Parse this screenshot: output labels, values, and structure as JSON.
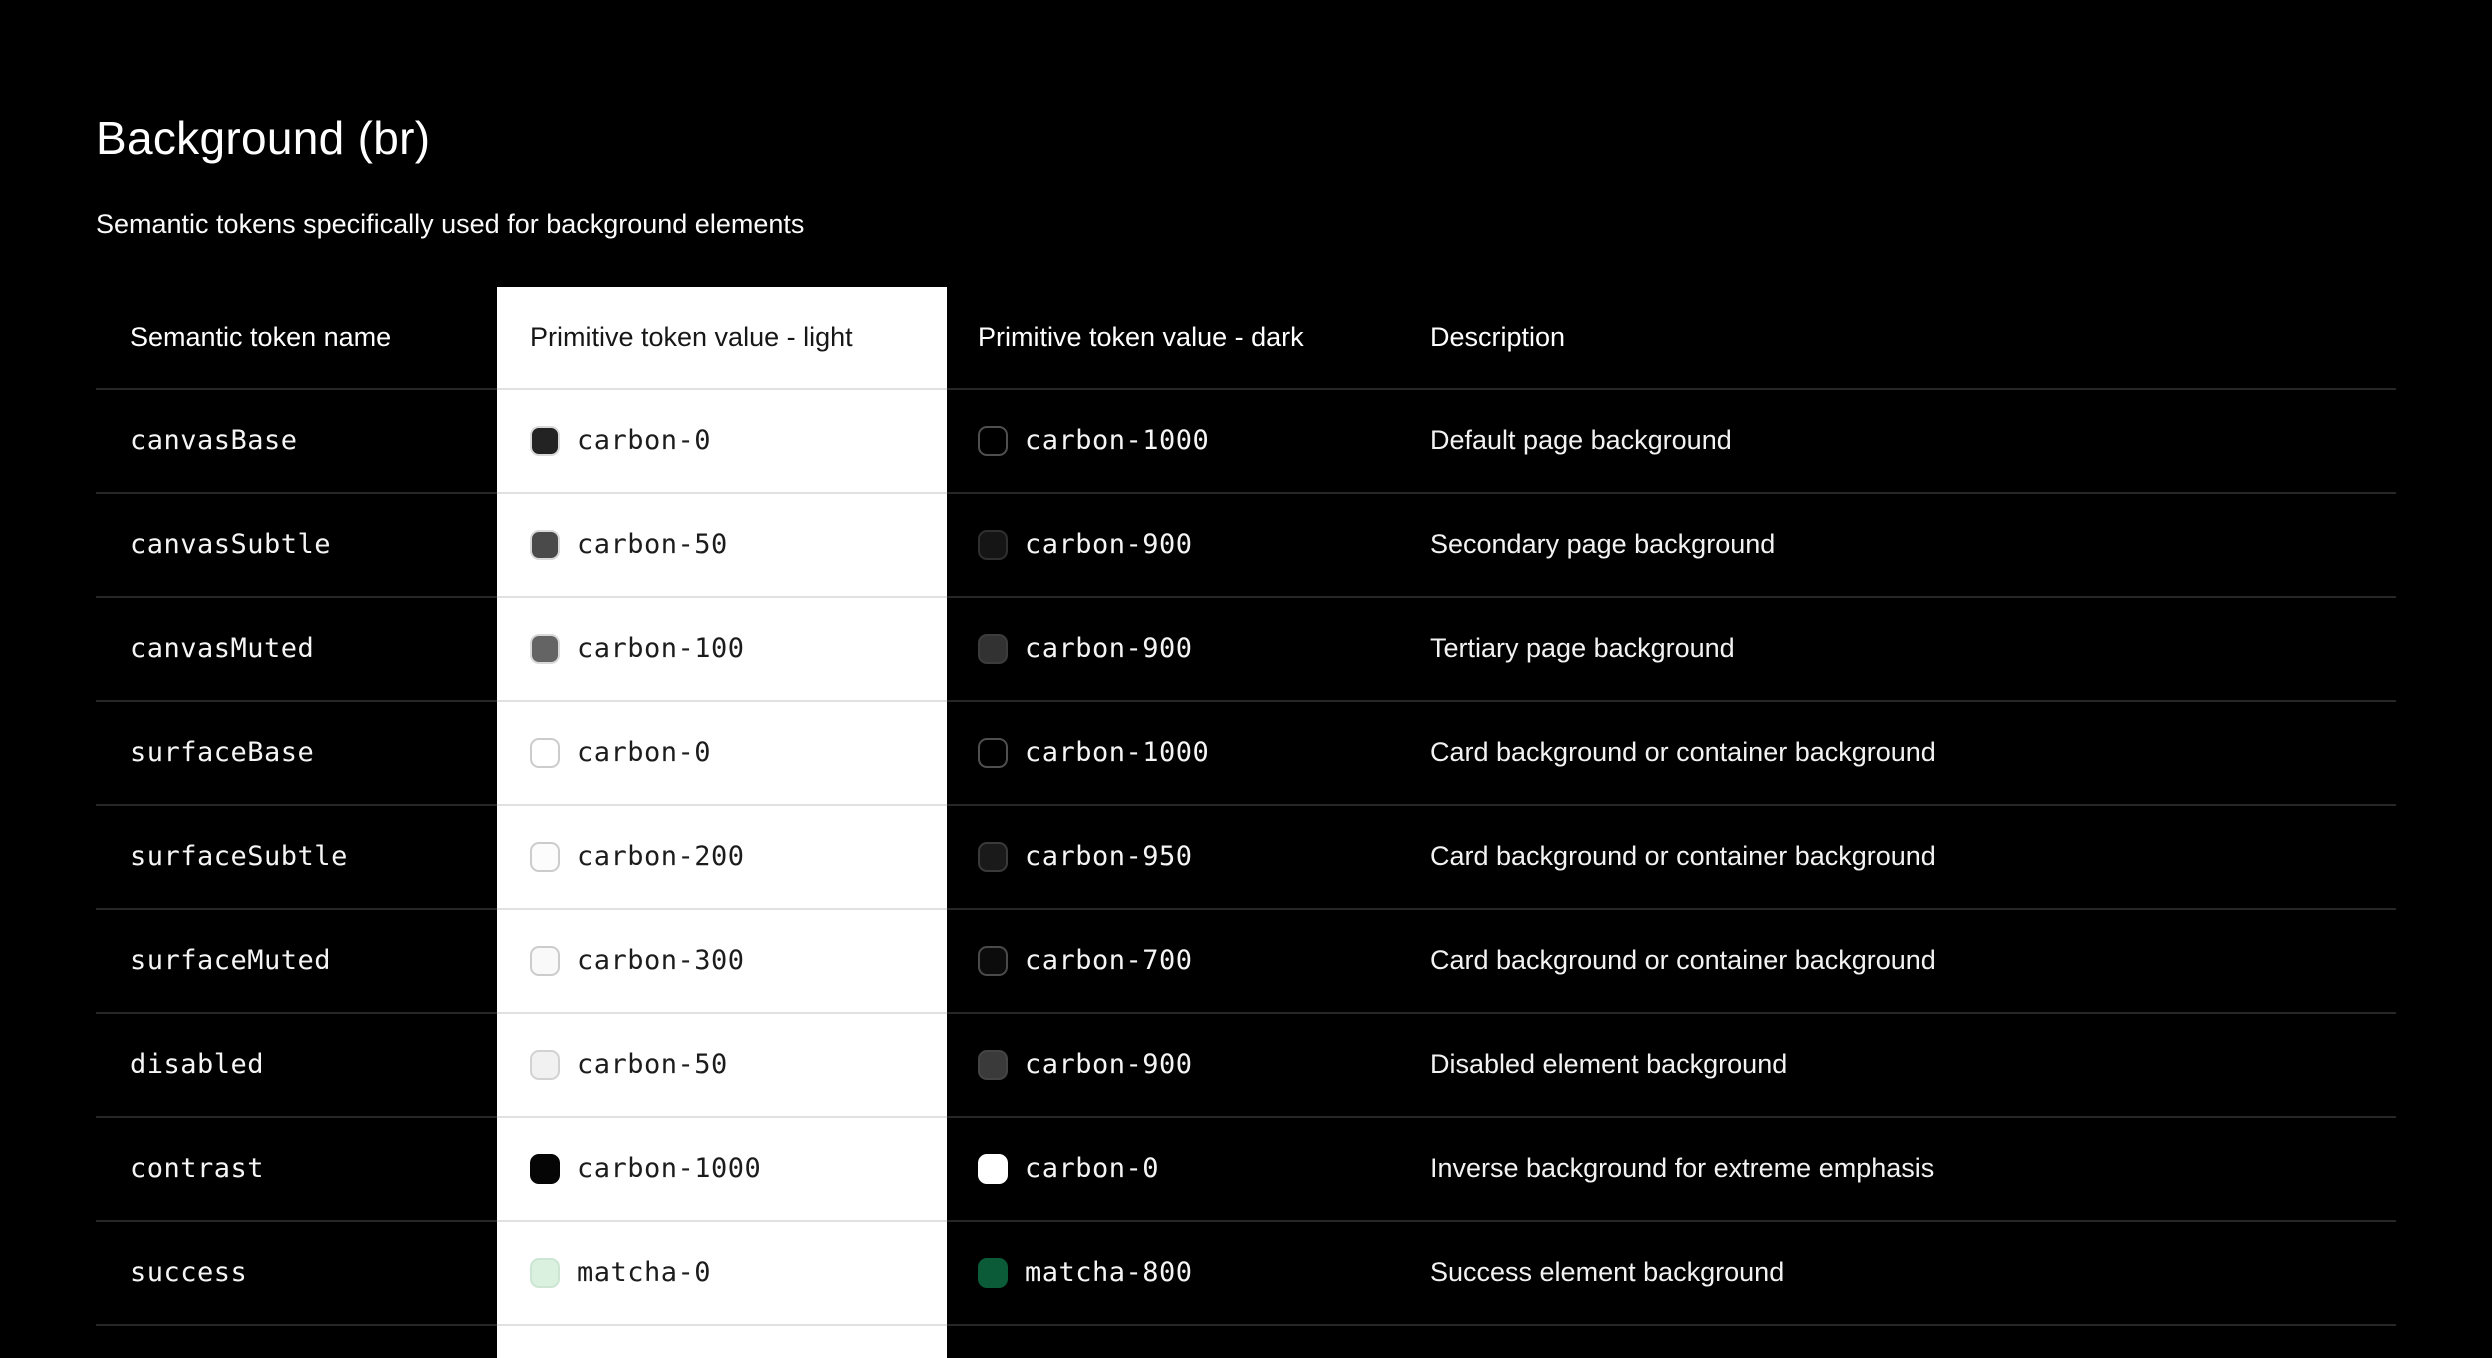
{
  "page": {
    "title": "Background (br)",
    "subtitle": "Semantic tokens specifically used for background elements"
  },
  "table": {
    "columns": [
      "Semantic token name",
      "Primitive token value - light",
      "Primitive token value - dark",
      "Description"
    ],
    "rows": [
      {
        "token": "canvasBase",
        "light": {
          "value": "carbon-0",
          "fill": "#232323",
          "border": "#d9d9d9"
        },
        "dark": {
          "value": "carbon-1000",
          "fill": "#000000",
          "border": "#4f4f4f"
        },
        "description": "Default page background"
      },
      {
        "token": "canvasSubtle",
        "light": {
          "value": "carbon-50",
          "fill": "#4a4a4a",
          "border": "#d9d9d9"
        },
        "dark": {
          "value": "carbon-900",
          "fill": "#151515",
          "border": "#2f2f2f"
        },
        "description": "Secondary page background"
      },
      {
        "token": "canvasMuted",
        "light": {
          "value": "carbon-100",
          "fill": "#646464",
          "border": "#d9d9d9"
        },
        "dark": {
          "value": "carbon-900",
          "fill": "#323232",
          "border": "#3c3c3c"
        },
        "description": "Tertiary page background"
      },
      {
        "token": "surfaceBase",
        "light": {
          "value": "carbon-0",
          "fill": "#ffffff",
          "border": "#cccccc"
        },
        "dark": {
          "value": "carbon-1000",
          "fill": "#000000",
          "border": "#4f4f4f"
        },
        "description": "Card background or container background"
      },
      {
        "token": "surfaceSubtle",
        "light": {
          "value": "carbon-200",
          "fill": "#fcfcfc",
          "border": "#cccccc"
        },
        "dark": {
          "value": "carbon-950",
          "fill": "#1a1a1a",
          "border": "#3a3a3a"
        },
        "description": "Card background or container background"
      },
      {
        "token": "surfaceMuted",
        "light": {
          "value": "carbon-300",
          "fill": "#f9f9f9",
          "border": "#cccccc"
        },
        "dark": {
          "value": "carbon-700",
          "fill": "#0c0c0c",
          "border": "#4a4a4a"
        },
        "description": "Card background or container background"
      },
      {
        "token": "disabled",
        "light": {
          "value": "carbon-50",
          "fill": "#f1f1f1",
          "border": "#d2d2d2"
        },
        "dark": {
          "value": "carbon-900",
          "fill": "#3a3a3a",
          "border": "#444444"
        },
        "description": "Disabled element background"
      },
      {
        "token": "contrast",
        "light": {
          "value": "carbon-1000",
          "fill": "#050505",
          "border": "#050505"
        },
        "dark": {
          "value": "carbon-0",
          "fill": "#ffffff",
          "border": "#ffffff"
        },
        "description": "Inverse background for extreme emphasis"
      },
      {
        "token": "success",
        "light": {
          "value": "matcha-0",
          "fill": "#d9f1de",
          "border": "#cde6d4"
        },
        "dark": {
          "value": "matcha-800",
          "fill": "#0b5b38",
          "border": "#0b5b38"
        },
        "description": "Success element background"
      }
    ]
  }
}
